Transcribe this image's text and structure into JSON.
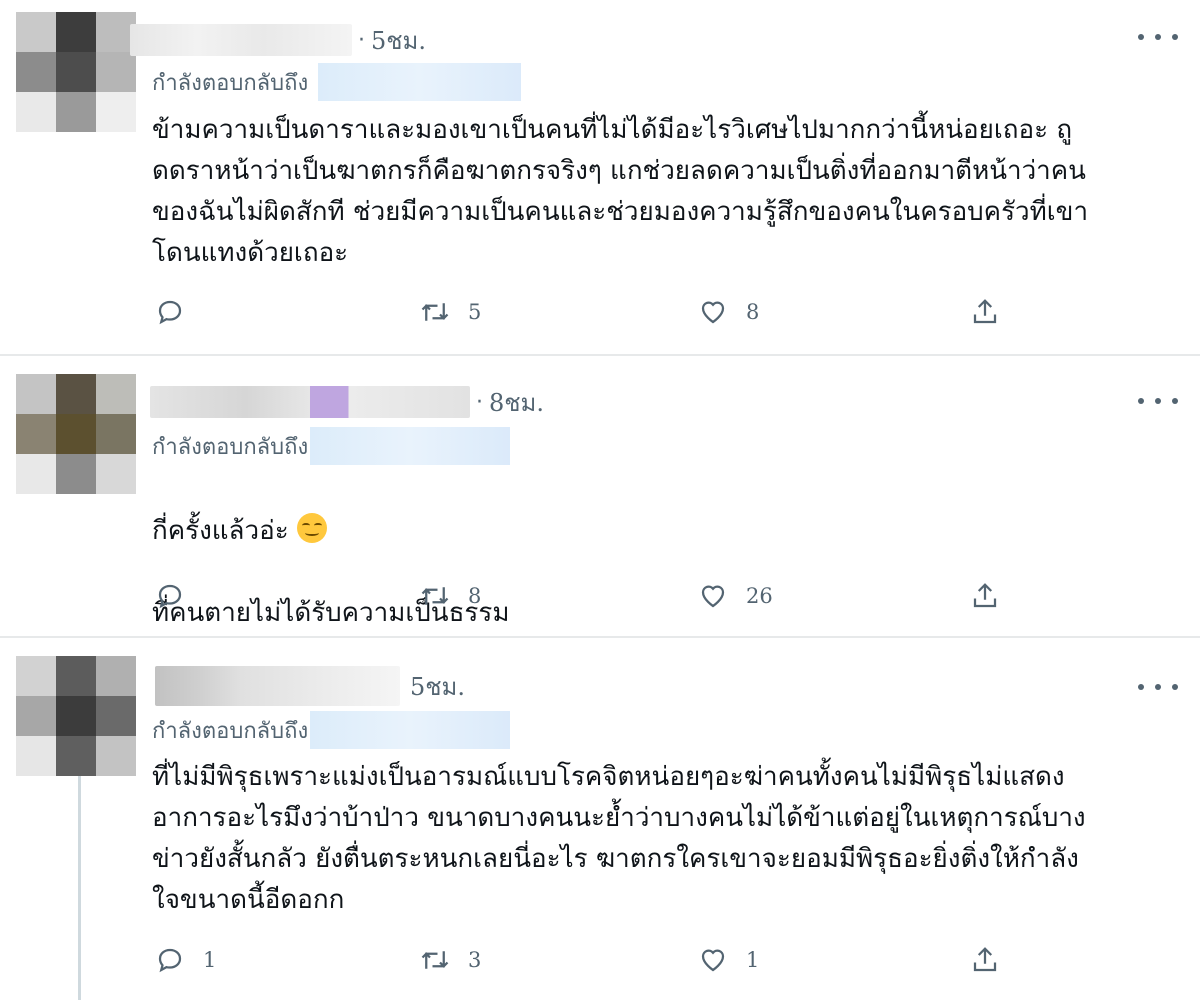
{
  "reply_label": "กำลังตอบกลับถึง",
  "tweets": [
    {
      "time": "5ชม.",
      "text": "ข้ามความเป็นดาราและมองเขาเป็นคนที่ไม่ได้มีอะไรวิเศษไปมากกว่านี้หน่อยเถอะ ถู\nดดราหน้าว่าเป็นฆาตกรก็คือฆาตกรจริงๆ แกช่วยลดความเป็นติ่งที่ออกมาตีหน้าว่าคน\nของฉันไม่ผิดสักที ช่วยมีความเป็นคนและช่วยมองความรู้สึกของคนในครอบครัวที่เขา\nโดนแทงด้วยเถอะ",
      "replies": "",
      "retweets": "5",
      "likes": "8"
    },
    {
      "time": "8ชม.",
      "line1": "กี่ครั้งแล้วอ่ะ",
      "line2": "ที่คนตายไม่ได้รับความเป็นธรรม",
      "replies": "",
      "retweets": "8",
      "likes": "26"
    },
    {
      "time": "5ชม.",
      "text": "ที่ไม่มีพิรุธเพราะแม่งเป็นอารมณ์แบบโรคจิตหน่อยๆอะฆ่าคนทั้งคนไม่มีพิรุธไม่แสดง\nอาการอะไรมึงว่าบ้าป่าว ขนาดบางคนนะย้ำว่าบางคนไม่ได้ข้าแต่อยู่ในเหตุการณ์บาง\nข่าวยังสั้นกลัว ยังตื่นตระหนกเลยนี่อะไร ฆาตกรใครเขาจะยอมมีพิรุธอะยิ่งติ่งให้กำลัง\nใจขนาดนี้อีดอกก",
      "replies": "1",
      "retweets": "3",
      "likes": "1"
    }
  ],
  "icons": {
    "reply": "reply-icon",
    "retweet": "retweet-icon",
    "like": "heart-icon",
    "share": "share-icon",
    "more": "more-icon"
  }
}
